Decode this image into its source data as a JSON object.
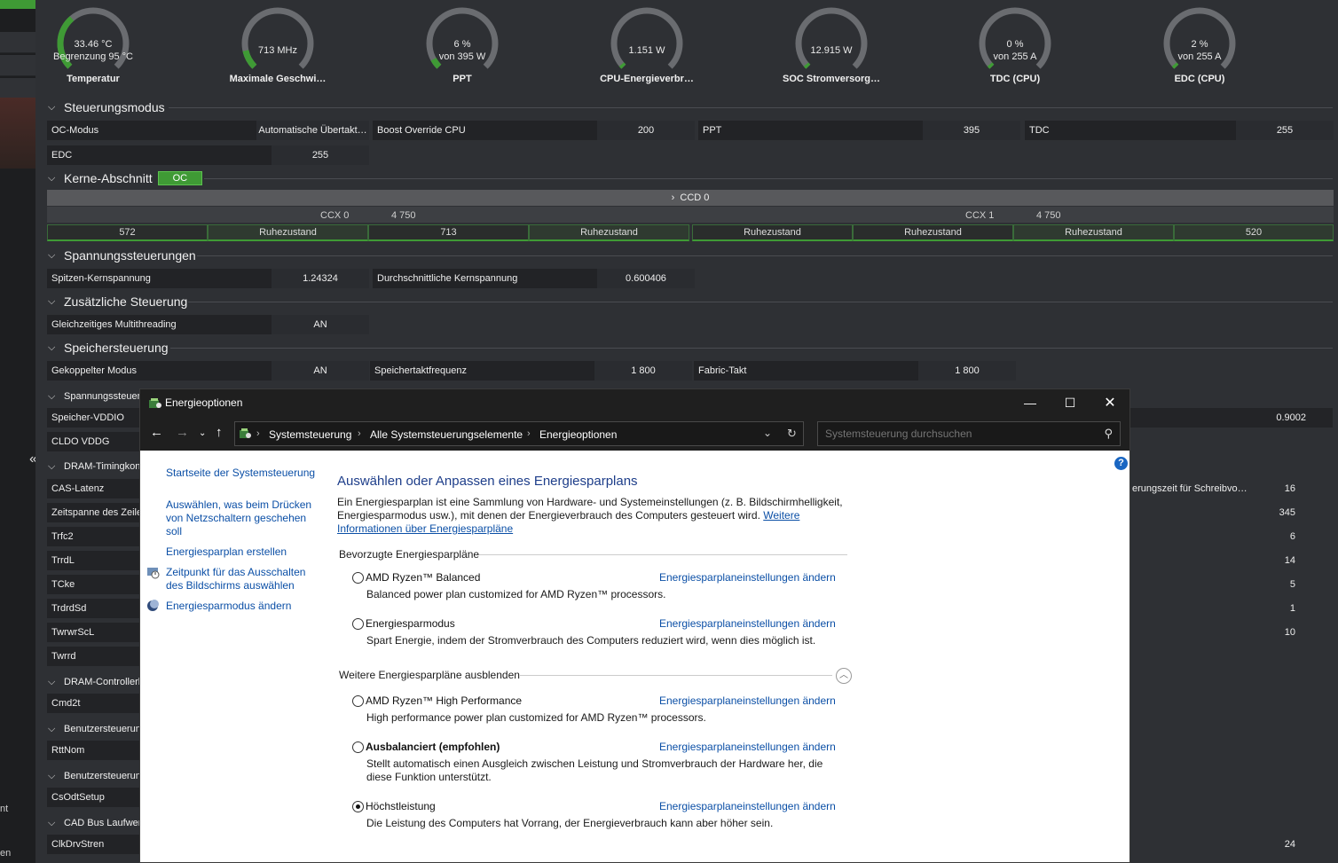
{
  "gauges": [
    {
      "line1": "33.46 °C",
      "line2": "Begrenzung 95 °C",
      "label": "Temperatur",
      "fill": 0.35
    },
    {
      "line1": "713  MHz",
      "line2": "",
      "label": "Maximale Geschwi…",
      "fill": 0.12
    },
    {
      "line1": "6 %",
      "line2": "von 395 W",
      "label": "PPT",
      "fill": 0.06
    },
    {
      "line1": "1.151 W",
      "line2": "",
      "label": "CPU-Energieverbr…",
      "fill": 0.02
    },
    {
      "line1": "12.915 W",
      "line2": "",
      "label": "SOC Stromversorg…",
      "fill": 0.02
    },
    {
      "line1": "0 %",
      "line2": "von 255 A",
      "label": "TDC (CPU)",
      "fill": 0.0
    },
    {
      "line1": "2 %",
      "line2": "von 255 A",
      "label": "EDC (CPU)",
      "fill": 0.02
    }
  ],
  "sections": {
    "control_mode": "Steuerungsmodus",
    "cores": "Kerne-Abschnitt",
    "cores_badge": "OC",
    "voltage": "Spannungssteuerungen",
    "additional": "Zusätzliche Steuerung",
    "memory": "Speichersteuerung",
    "voltage2": "Spannungssteuer",
    "dram_timing": "DRAM-Timingkonf",
    "dram_controller": "DRAM-Controllerk",
    "user1": "Benutzersteuerun",
    "user2": "Benutzersteuerun",
    "cad": "CAD Bus Laufwerk"
  },
  "control_rows": {
    "oc_mode_k": "OC-Modus",
    "oc_mode_v": "Automatische Übertakt…",
    "boost_k": "Boost Override CPU",
    "boost_v": "200",
    "ppt_k": "PPT",
    "ppt_v": "395",
    "tdc_k": "TDC",
    "tdc_v": "255",
    "edc_k": "EDC",
    "edc_v": "255"
  },
  "ccd": {
    "label": "CCD 0",
    "ccx0": "CCX 0",
    "ccx0_freq": "4 750",
    "ccx1": "CCX 1",
    "ccx1_freq": "4 750",
    "cores": [
      "572",
      "Ruhezustand",
      "713",
      "Ruhezustand",
      "Ruhezustand",
      "Ruhezustand",
      "Ruhezustand",
      "520"
    ]
  },
  "voltage_rows": {
    "peak_k": "Spitzen-Kernspannung",
    "peak_v": "1.24324",
    "avg_k": "Durchschnittliche Kernspannung",
    "avg_v": "0.600406"
  },
  "additional_rows": {
    "smt_k": "Gleichzeitiges Multithreading",
    "smt_v": "AN"
  },
  "memory_rows": {
    "coupled_k": "Gekoppelter Modus",
    "coupled_v": "AN",
    "memclk_k": "Speichertaktfrequenz",
    "memclk_v": "1 800",
    "fabric_k": "Fabric-Takt",
    "fabric_v": "1 800"
  },
  "left_rows": [
    "Speicher-VDDIO",
    "CLDO VDDG",
    "CAS-Latenz",
    "Zeitspanne des Zeile",
    "Trfc2",
    "TrrdL",
    "TCke",
    "TrdrdSd",
    "TwrwrScL",
    "Twrrd",
    "Cmd2t",
    "RttNom",
    "CsOdtSetup",
    "ClkDrvStren"
  ],
  "right_values": {
    "v1": "0.9002",
    "v2_label": "erungszeit für Schreibvo…",
    "v2": "16",
    "v3": "345",
    "v4": "6",
    "v5": "14",
    "v6": "5",
    "v7": "1",
    "v8": "10",
    "v9": "24"
  },
  "left_strip": {
    "lbl1": "nt",
    "lbl2": "en"
  },
  "dialog": {
    "title": "Energieoptionen",
    "crumbs": [
      "Systemsteuerung",
      "Alle Systemsteuerungselemente",
      "Energieoptionen"
    ],
    "search_placeholder": "Systemsteuerung durchsuchen",
    "side_links": [
      "Startseite der Systemsteuerung",
      "Auswählen, was beim Drücken von Netzschaltern geschehen soll",
      "Energiesparplan erstellen",
      "Zeitpunkt für das Ausschalten des Bildschirms auswählen",
      "Energiesparmodus ändern"
    ],
    "heading": "Auswählen oder Anpassen eines Energiesparplans",
    "desc": "Ein Energiesparplan ist eine Sammlung von Hardware- und Systemeinstellungen (z. B. Bildschirmhelligkeit, Energiesparmodus usw.), mit denen der Energieverbrauch des Computers gesteuert wird.",
    "desc_link": "Weitere Informationen über Energiesparpläne",
    "group1": "Bevorzugte Energiesparpläne",
    "group2": "Weitere Energiesparpläne ausblenden",
    "change_link": "Energiesparplaneinstellungen ändern",
    "plans": [
      {
        "name": "AMD Ryzen™ Balanced",
        "desc": "Balanced power plan customized for AMD Ryzen™ processors.",
        "selected": false
      },
      {
        "name": "Energiesparmodus",
        "desc": "Spart Energie, indem der Stromverbrauch des Computers reduziert wird, wenn dies möglich ist.",
        "selected": false
      },
      {
        "name": "AMD Ryzen™ High Performance",
        "desc": "High performance power plan customized for AMD Ryzen™ processors.",
        "selected": false
      },
      {
        "name": "Ausbalanciert (empfohlen)",
        "desc": "Stellt automatisch einen Ausgleich zwischen Leistung und Stromverbrauch der Hardware her, die diese Funktion unterstützt.",
        "selected": false
      },
      {
        "name": "Höchstleistung",
        "desc": "Die Leistung des Computers hat Vorrang, der Energieverbrauch kann aber höher sein.",
        "selected": true
      }
    ]
  },
  "colors": {
    "accent_green": "#3f9a35",
    "link_blue": "#0b4fa6",
    "title_blue": "#1e3e8a"
  }
}
